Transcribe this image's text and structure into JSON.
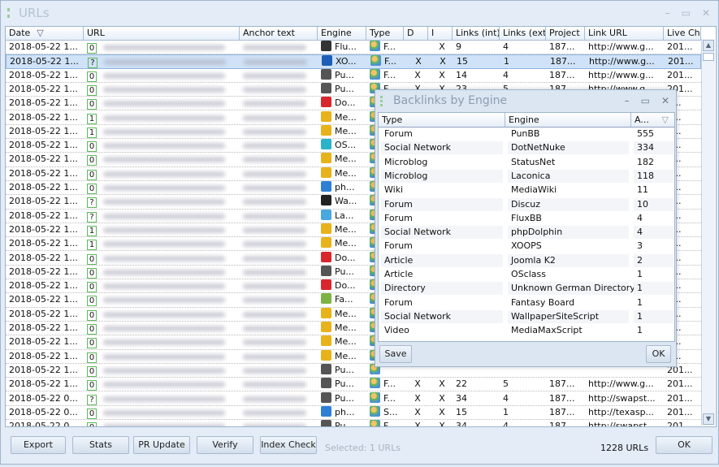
{
  "window": {
    "title": "URLs",
    "icon": "app-icon"
  },
  "columns": [
    "Date",
    "URL",
    "Anchor text",
    "Engine",
    "Type",
    "D",
    "I",
    "Links (int)",
    "Links (ext)",
    "Project",
    "Link URL",
    "Live Che"
  ],
  "sort_indicator": "▽",
  "rows": [
    {
      "date": "2018-05-22 1...",
      "pr": "0",
      "engine": "Flu...",
      "eicon": "fluxbb",
      "type": "F...",
      "d": "",
      "i": "X",
      "li": "9",
      "le": "4",
      "proj": "187...",
      "link": "http://www.g...",
      "live": "201..."
    },
    {
      "date": "2018-05-22 1...",
      "pr": "?",
      "engine": "XO...",
      "eicon": "xoops",
      "type": "F...",
      "d": "X",
      "i": "X",
      "li": "15",
      "le": "1",
      "proj": "187...",
      "link": "http://www.g...",
      "live": "201...",
      "selected": true
    },
    {
      "date": "2018-05-22 1...",
      "pr": "0",
      "engine": "Pu...",
      "eicon": "punbb",
      "type": "F...",
      "d": "X",
      "i": "X",
      "li": "14",
      "le": "4",
      "proj": "187...",
      "link": "http://www.g...",
      "live": "201..."
    },
    {
      "date": "2018-05-22 1...",
      "pr": "0",
      "engine": "Pu...",
      "eicon": "punbb",
      "type": "F...",
      "d": "X",
      "i": "X",
      "li": "23",
      "le": "5",
      "proj": "187...",
      "link": "http://www.g...",
      "live": "201..."
    },
    {
      "date": "2018-05-22 1...",
      "pr": "0",
      "engine": "Do...",
      "eicon": "dotnetnuke",
      "live": "1..."
    },
    {
      "date": "2018-05-22 1...",
      "pr": "1",
      "engine": "Me...",
      "eicon": "mediawiki",
      "live": "1..."
    },
    {
      "date": "2018-05-22 1...",
      "pr": "1",
      "engine": "Me...",
      "eicon": "mediawiki",
      "live": "1..."
    },
    {
      "date": "2018-05-22 1...",
      "pr": "0",
      "engine": "OS...",
      "eicon": "osclass",
      "live": "1..."
    },
    {
      "date": "2018-05-22 1...",
      "pr": "0",
      "engine": "Me...",
      "eicon": "mediawiki",
      "live": "1..."
    },
    {
      "date": "2018-05-22 1...",
      "pr": "0",
      "engine": "Me...",
      "eicon": "mediawiki",
      "live": "1..."
    },
    {
      "date": "2018-05-22 1...",
      "pr": "0",
      "engine": "ph...",
      "eicon": "phpdolphin",
      "live": "1..."
    },
    {
      "date": "2018-05-22 1...",
      "pr": "?",
      "engine": "Wa...",
      "eicon": "wallpaper",
      "live": "1..."
    },
    {
      "date": "2018-05-22 1...",
      "pr": "?",
      "engine": "La...",
      "eicon": "laconica",
      "live": "1..."
    },
    {
      "date": "2018-05-22 1...",
      "pr": "1",
      "engine": "Me...",
      "eicon": "mediawiki",
      "live": "1..."
    },
    {
      "date": "2018-05-22 1...",
      "pr": "1",
      "engine": "Me...",
      "eicon": "mediawiki",
      "live": "1..."
    },
    {
      "date": "2018-05-22 1...",
      "pr": "0",
      "engine": "Do...",
      "eicon": "dotnetnuke",
      "live": "1..."
    },
    {
      "date": "2018-05-22 1...",
      "pr": "0",
      "engine": "Pu...",
      "eicon": "punbb",
      "live": "1..."
    },
    {
      "date": "2018-05-22 1...",
      "pr": "0",
      "engine": "Do...",
      "eicon": "dotnetnuke",
      "live": "1..."
    },
    {
      "date": "2018-05-22 1...",
      "pr": "0",
      "engine": "Fa...",
      "eicon": "fantasy",
      "live": "1..."
    },
    {
      "date": "2018-05-22 1...",
      "pr": "0",
      "engine": "Me...",
      "eicon": "mediawiki",
      "live": "1..."
    },
    {
      "date": "2018-05-22 1...",
      "pr": "0",
      "engine": "Me...",
      "eicon": "mediawiki",
      "live": "1..."
    },
    {
      "date": "2018-05-22 1...",
      "pr": "0",
      "engine": "Me...",
      "eicon": "mediawiki",
      "live": "1..."
    },
    {
      "date": "2018-05-22 1...",
      "pr": "0",
      "engine": "Me...",
      "eicon": "mediawiki",
      "live": "1..."
    },
    {
      "date": "2018-05-22 1...",
      "pr": "0",
      "engine": "Pu...",
      "eicon": "punbb",
      "live": "201..."
    },
    {
      "date": "2018-05-22 1...",
      "pr": "0",
      "engine": "Pu...",
      "eicon": "punbb",
      "type": "F...",
      "d": "X",
      "i": "X",
      "li": "22",
      "le": "5",
      "proj": "187...",
      "link": "http://www.g...",
      "live": "201..."
    },
    {
      "date": "2018-05-22 0...",
      "pr": "?",
      "engine": "Pu...",
      "eicon": "punbb",
      "type": "F...",
      "d": "X",
      "i": "X",
      "li": "34",
      "le": "4",
      "proj": "187...",
      "link": "http://swapst...",
      "live": "201..."
    },
    {
      "date": "2018-05-22 0...",
      "pr": "0",
      "engine": "ph...",
      "eicon": "phpdolphin",
      "type": "S...",
      "d": "X",
      "i": "X",
      "li": "15",
      "le": "1",
      "proj": "187...",
      "link": "http://texasp...",
      "live": "201..."
    },
    {
      "date": "2018-05-22 0...",
      "pr": "0",
      "engine": "Pu...",
      "eicon": "punbb",
      "type": "F...",
      "d": "X",
      "i": "X",
      "li": "34",
      "le": "4",
      "proj": "187...",
      "link": "http://swapst...",
      "live": "201..."
    }
  ],
  "footer": {
    "export": "Export",
    "stats": "Stats",
    "pr_update": "PR Update",
    "verify": "Verify",
    "index_check": "Index Check",
    "selected": "Selected: 1 URLs",
    "count": "1228 URLs",
    "ok": "OK"
  },
  "dialog": {
    "title": "Backlinks by Engine",
    "columns": [
      "Type",
      "Engine",
      "A..."
    ],
    "rows": [
      [
        "Forum",
        "PunBB",
        "555"
      ],
      [
        "Social Network",
        "DotNetNuke",
        "334"
      ],
      [
        "Microblog",
        "StatusNet",
        "182"
      ],
      [
        "Microblog",
        "Laconica",
        "118"
      ],
      [
        "Wiki",
        "MediaWiki",
        "11"
      ],
      [
        "Forum",
        "Discuz",
        "10"
      ],
      [
        "Forum",
        "FluxBB",
        "4"
      ],
      [
        "Social Network",
        "phpDolphin",
        "4"
      ],
      [
        "Forum",
        "XOOPS",
        "3"
      ],
      [
        "Article",
        "Joomla K2",
        "2"
      ],
      [
        "Article",
        "OSclass",
        "1"
      ],
      [
        "Directory",
        "Unknown German Directory",
        "1"
      ],
      [
        "Forum",
        "Fantasy Board",
        "1"
      ],
      [
        "Social Network",
        "WallpaperSiteScript",
        "1"
      ],
      [
        "Video",
        "MediaMaxScript",
        "1"
      ]
    ],
    "save": "Save",
    "ok": "OK"
  },
  "colors": {
    "engine_icons": {
      "fluxbb": "#333",
      "xoops": "#1d5fb8",
      "punbb": "#555",
      "dotnetnuke": "#d9262c",
      "mediawiki": "#e8b21a",
      "osclass": "#2bb3c9",
      "phpdolphin": "#2d7fd6",
      "wallpaper": "#222",
      "laconica": "#4aa8e0",
      "fantasy": "#7cb342"
    },
    "badge": "#5cb85c",
    "selection": "#cfe2f7"
  }
}
